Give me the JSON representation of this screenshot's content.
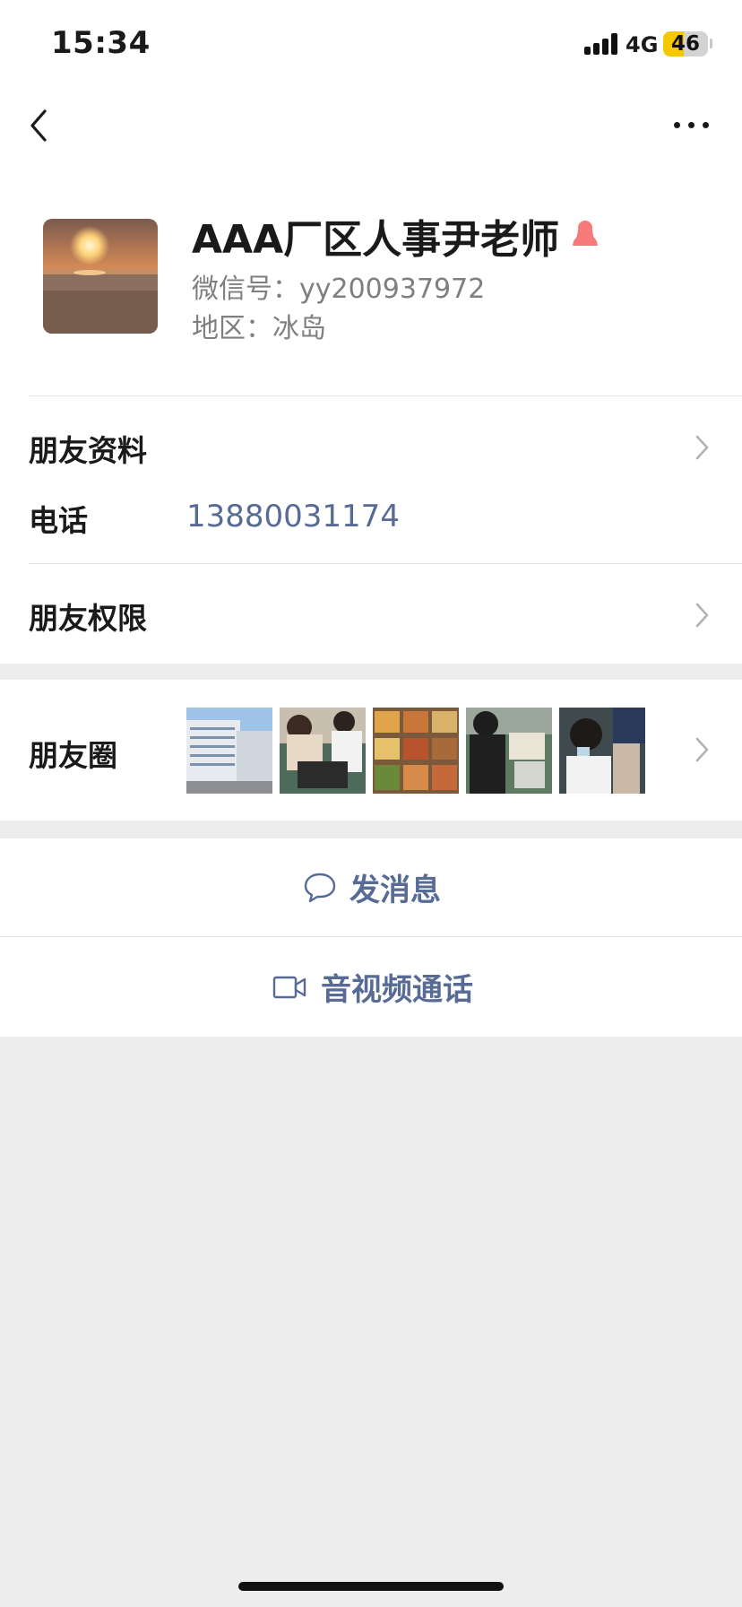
{
  "status_bar": {
    "time": "15:34",
    "network": "4G",
    "battery": "46",
    "battery_level": 0.46
  },
  "nav": {
    "back_icon": "chevron-left-icon",
    "more_icon": "ellipsis-icon"
  },
  "profile": {
    "name": "AAA厂区人事尹老师",
    "wechat_id": "微信号：yy200937972",
    "region": "地区：冰岛",
    "gender_icon": "female-icon",
    "gender_color": "#fa5151"
  },
  "rows": {
    "friend_profile": "朋友资料",
    "phone_label": "电话",
    "phone_value": "13880031174",
    "friend_permissions": "朋友权限",
    "moments_label": "朋友圈"
  },
  "actions": {
    "send_message": "发消息",
    "av_call": "音视频通话",
    "link_color": "#576b95"
  }
}
